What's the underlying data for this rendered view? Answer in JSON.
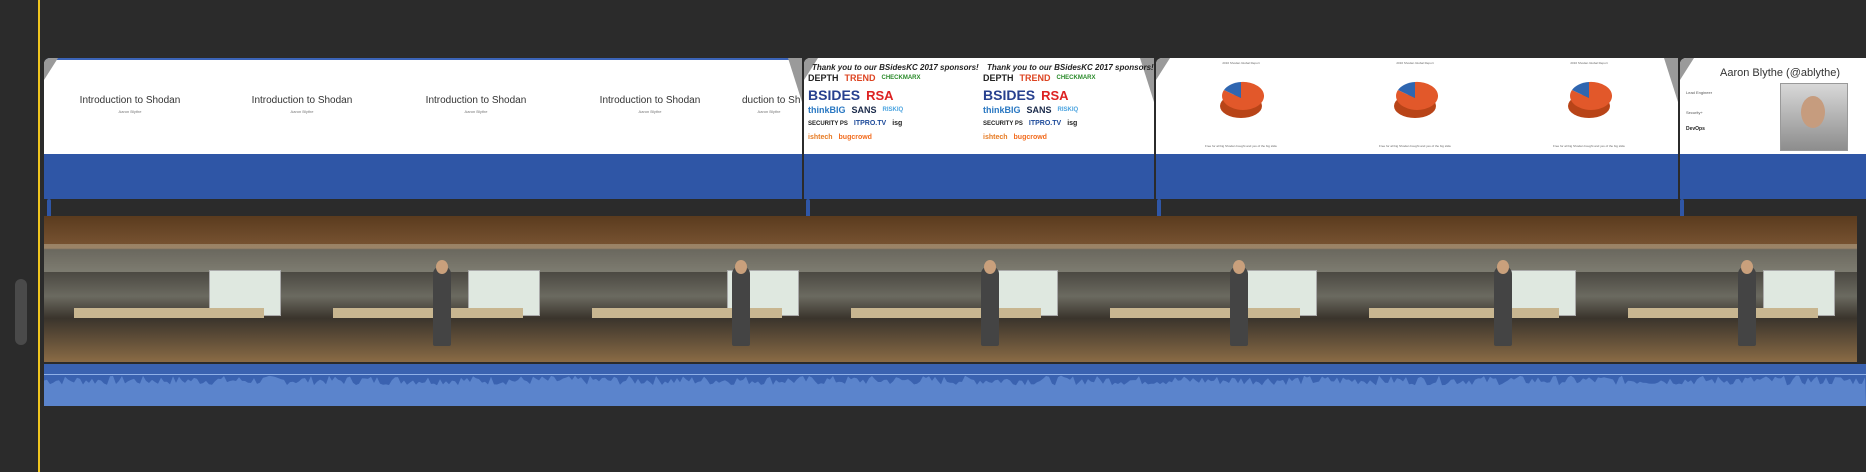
{
  "intro_slide": {
    "title": "Introduction to Shodan",
    "title_cut": "duction to Sh",
    "subtitle": "Aaron Blythe"
  },
  "sponsor_slide": {
    "heading": "Thank you to our BSidesKC 2017 sponsors!",
    "logos": [
      "DEPTH",
      "TREND",
      "CHECKMARX",
      "BSIDES",
      "RSA",
      "thinkBIG",
      "SANS",
      "RISKIQ",
      "SECURITY PS",
      "ITPRO.TV",
      "isg",
      "ishtech",
      "bugcrowd"
    ]
  },
  "chart_slide": {
    "heading": "2016 Shodan Global Report",
    "footer": "Free for all big Shodan bought and yes of the big slide",
    "colors": {
      "slice_main": "#e2582a",
      "slice_blue": "#2f66b0"
    }
  },
  "speaker_slide": {
    "name": "Aaron Blythe (@ablythe)",
    "bullets": [
      "Lead Engineer",
      "Security+",
      "DevOps"
    ]
  },
  "colors": {
    "playhead": "#f0c51e",
    "title_clip": "#2f56a6",
    "audio": "#3a62b0"
  }
}
